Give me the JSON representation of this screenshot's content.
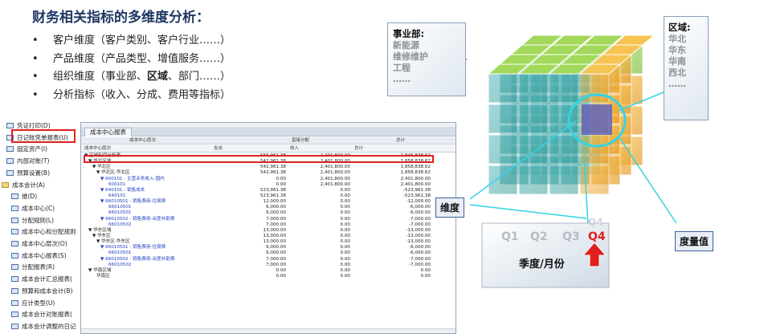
{
  "slide": {
    "title": "财务相关指标的多维度分析：",
    "bullet_marker": "•",
    "bullets": [
      "客户维度（客户类别、客户行业……）",
      "产品维度（产品类型、增值服务……）",
      "组织维度（事业部、",
      "区域",
      "、部门……）",
      "分析指标（收入、分成、费用等指标）"
    ]
  },
  "nav": {
    "items": [
      "凭证打印(D)",
      "日记账凭单报表(U)",
      "固定资产(I)",
      "内部对账(T)",
      "预算设置(B)",
      "成本会计(A)",
      "维(D)",
      "成本中心(C)",
      "分配规则(L)",
      "成本中心和分配规则",
      "成本中心层次(O)",
      "成本中心报表(S)",
      "分配报表(R)",
      "成本会计汇总报表(",
      "预算和成本会计(B)",
      "应计类型(U)",
      "成本会计对账报表(",
      "成本会计调整的日记"
    ]
  },
  "report": {
    "tab": "成本中心报表",
    "col_group": "成本中心层次",
    "col_direct": "直接分配",
    "col_total": "总计",
    "sub_cols": [
      "成本中心层次",
      "支出",
      "收入",
      "总计"
    ],
    "rows": [
      {
        "label": "▼ 区域利润分析表",
        "c1": "555,961.38",
        "c2": "2,401,800.00",
        "c3": "1,845,838.62",
        "indent": 0,
        "blue": false
      },
      {
        "label": "▼ 华北区域",
        "c1": "542,961.38",
        "c2": "2,401,800.00",
        "c3": "1,858,838.62",
        "indent": 1,
        "blue": false
      },
      {
        "label": "▼ 华北区",
        "c1": "542,961.38",
        "c2": "2,401,800.00",
        "c3": "1,858,838.62",
        "indent": 2,
        "blue": false
      },
      {
        "label": "▼ 华北区-华北区",
        "c1": "542,961.38",
        "c2": "2,401,800.00",
        "c3": "1,858,838.62",
        "indent": 3,
        "blue": false
      },
      {
        "label": "▼ 600101 - 主营业务收入-国内",
        "c1": "0.00",
        "c2": "2,401,800.00",
        "c3": "2,401,800.00",
        "indent": 4,
        "blue": true
      },
      {
        "label": "600101",
        "c1": "0.00",
        "c2": "2,401,800.00",
        "c3": "2,401,800.00",
        "indent": 6,
        "blue": true
      },
      {
        "label": "▼ 640101 - 销售成本",
        "c1": "523,961.38",
        "c2": "0.00",
        "c3": "-523,961.38",
        "indent": 4,
        "blue": true
      },
      {
        "label": "640101",
        "c1": "523,961.38",
        "c2": "0.00",
        "c3": "-523,961.38",
        "indent": 6,
        "blue": true
      },
      {
        "label": "▼ 66010501 - 销售费用-住宿费",
        "c1": "12,000.00",
        "c2": "0.00",
        "c3": "-12,000.00",
        "indent": 4,
        "blue": true
      },
      {
        "label": "66010501",
        "c1": "6,000.00",
        "c2": "0.00",
        "c3": "-6,000.00",
        "indent": 6,
        "blue": true
      },
      {
        "label": "66010501",
        "c1": "6,000.00",
        "c2": "0.00",
        "c3": "-6,000.00",
        "indent": 6,
        "blue": true
      },
      {
        "label": "▼ 66010502 - 销售费用-出差补助费",
        "c1": "7,000.00",
        "c2": "0.00",
        "c3": "-7,000.00",
        "indent": 4,
        "blue": true
      },
      {
        "label": "66010502",
        "c1": "7,000.00",
        "c2": "0.00",
        "c3": "-7,000.00",
        "indent": 6,
        "blue": true
      },
      {
        "label": "▼ 华东区域",
        "c1": "13,000.00",
        "c2": "0.00",
        "c3": "-13,000.00",
        "indent": 1,
        "blue": false
      },
      {
        "label": "▼ 华东区",
        "c1": "13,000.00",
        "c2": "0.00",
        "c3": "-13,000.00",
        "indent": 2,
        "blue": false
      },
      {
        "label": "▼ 华东区-华东区",
        "c1": "13,000.00",
        "c2": "0.00",
        "c3": "-13,000.00",
        "indent": 3,
        "blue": false
      },
      {
        "label": "▼ 66010501 - 销售费用-住宿费",
        "c1": "6,000.00",
        "c2": "0.00",
        "c3": "-6,000.00",
        "indent": 4,
        "blue": true
      },
      {
        "label": "66010501",
        "c1": "6,000.00",
        "c2": "0.00",
        "c3": "-6,000.00",
        "indent": 6,
        "blue": true
      },
      {
        "label": "▼ 66010502 - 销售费用-出差补助费",
        "c1": "7,000.00",
        "c2": "0.00",
        "c3": "-7,000.00",
        "indent": 4,
        "blue": true
      },
      {
        "label": "66010502",
        "c1": "7,000.00",
        "c2": "0.00",
        "c3": "-7,000.00",
        "indent": 6,
        "blue": true
      },
      {
        "label": "▼ 华南区域",
        "c1": "0.00",
        "c2": "0.00",
        "c3": "0.00",
        "indent": 1,
        "blue": false
      },
      {
        "label": "华南区",
        "c1": "0.00",
        "c2": "0.00",
        "c3": "0.00",
        "indent": 3,
        "blue": false
      }
    ]
  },
  "cube": {
    "business_unit_title": "事业部:",
    "business_units": [
      "新能源",
      "维修维护",
      "工程",
      "……"
    ],
    "region_title": "区域:",
    "regions": [
      "华北",
      "华东",
      "华南",
      "西北",
      "……"
    ],
    "dimension_label": "维度",
    "measure_label": "度量值",
    "quarters": [
      "Q1",
      "Q2",
      "Q3",
      "Q4"
    ],
    "quarter_ghost": "Q4",
    "period_label": "季度/月份",
    "colors": {
      "green_face": "#8fd14f",
      "teal_face": "#4fb3a9",
      "orange_face": "#f2b03c",
      "highlight": "#33d4e6",
      "arrow_red": "#e02020",
      "q4_red": "#e02020"
    }
  }
}
